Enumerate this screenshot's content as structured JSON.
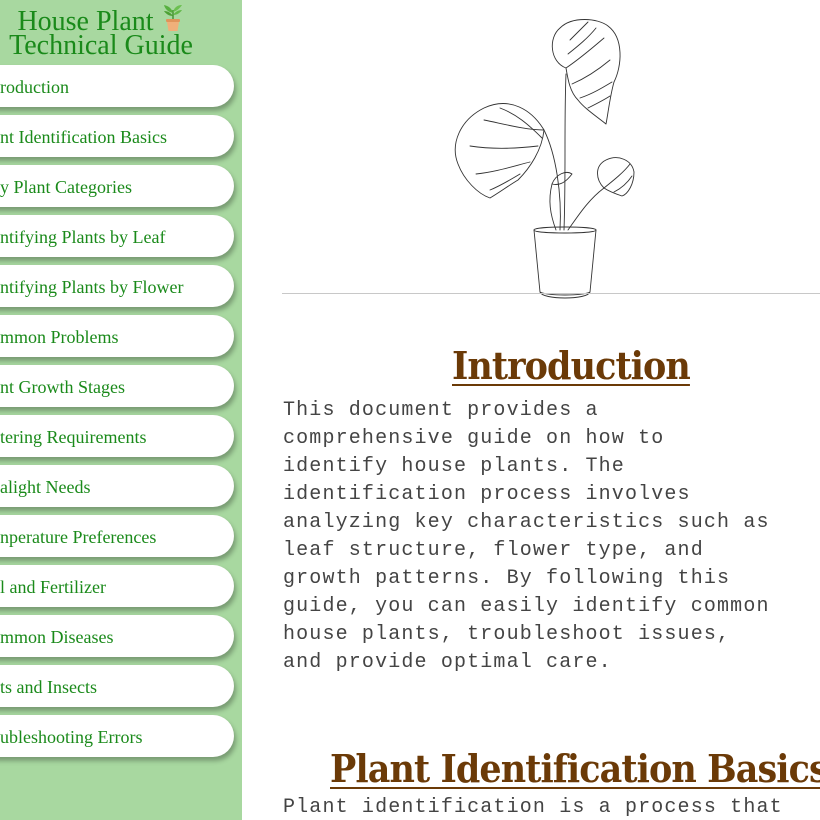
{
  "sidebar": {
    "title_line1": "House Plant",
    "title_line2": "Technical Guide",
    "items": [
      {
        "label": "Introduction",
        "visible_text": "roduction"
      },
      {
        "label": "Plant Identification Basics",
        "visible_text": "nt Identification Basics"
      },
      {
        "label": "Key Plant Categories",
        "visible_text": "y Plant Categories"
      },
      {
        "label": "Identifying Plants by Leaf",
        "visible_text": "ntifying Plants by Leaf"
      },
      {
        "label": "Identifying Plants by Flower",
        "visible_text": "ntifying Plants by Flower"
      },
      {
        "label": "Common Problems",
        "visible_text": "mmon Problems"
      },
      {
        "label": "Plant Growth Stages",
        "visible_text": "nt Growth Stages"
      },
      {
        "label": "Watering Requirements",
        "visible_text": "tering Requirements"
      },
      {
        "label": "Sunlight Needs",
        "visible_text": "alight Needs"
      },
      {
        "label": "Temperature Preferences",
        "visible_text": "nperature Preferences"
      },
      {
        "label": "Soil and Fertilizer",
        "visible_text": "l and Fertilizer"
      },
      {
        "label": "Common Diseases",
        "visible_text": "mmon Diseases"
      },
      {
        "label": "Pests and Insects",
        "visible_text": "ts and Insects"
      },
      {
        "label": "Troubleshooting Errors",
        "visible_text": "ubleshooting Errors"
      }
    ]
  },
  "main": {
    "hero_icon": "monstera-plant-line-art",
    "sections": [
      {
        "heading": "Introduction",
        "text": "This document provides a\ncomprehensive guide on how to\nidentify house plants. The\nidentification process involves\nanalyzing key characteristics such as\nleaf structure, flower type, and\ngrowth patterns. By following this\nguide, you can easily identify common\nhouse plants, troubleshoot issues,\nand provide optimal care."
      },
      {
        "heading": "Plant Identification Basics",
        "text": "Plant identification is a process that"
      }
    ]
  },
  "colors": {
    "sidebar_bg": "#a8d8a0",
    "nav_text": "#1a8a1a",
    "heading": "#6b3a07",
    "body_text": "#444444"
  }
}
